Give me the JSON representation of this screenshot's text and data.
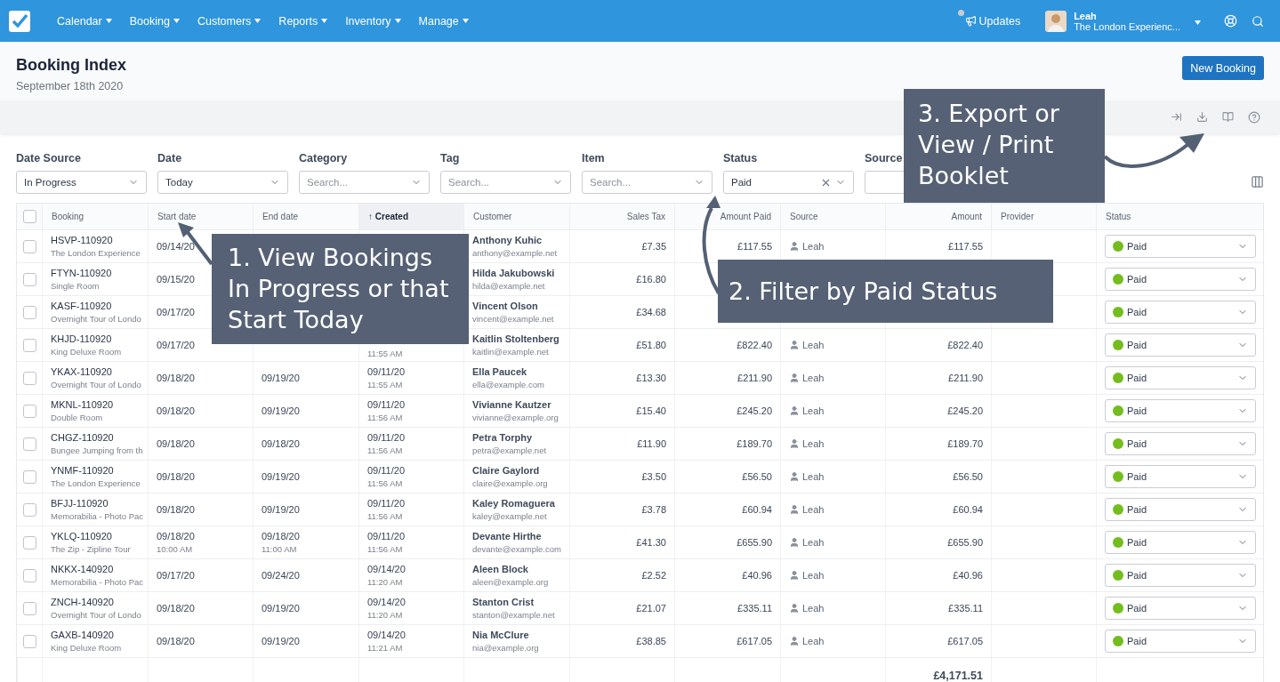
{
  "nav": {
    "menus": [
      {
        "label": "Calendar"
      },
      {
        "label": "Booking"
      },
      {
        "label": "Customers"
      },
      {
        "label": "Reports"
      },
      {
        "label": "Inventory"
      },
      {
        "label": "Manage"
      }
    ],
    "updates": {
      "label": "Updates",
      "unread": true
    },
    "user": {
      "name": "Leah",
      "company": "The London Experienc..."
    }
  },
  "header": {
    "title": "Booking Index",
    "date": "September 18th 2020",
    "button": "New Booking"
  },
  "filters": [
    {
      "label": "Date Source",
      "value": "In Progress",
      "clearable": false
    },
    {
      "label": "Date",
      "value": "Today",
      "clearable": false
    },
    {
      "label": "Category",
      "placeholder": "Search...",
      "clearable": false
    },
    {
      "label": "Tag",
      "placeholder": "Search...",
      "clearable": false
    },
    {
      "label": "Item",
      "placeholder": "Search...",
      "clearable": false
    },
    {
      "label": "Status",
      "value": "Paid",
      "clearable": true
    },
    {
      "label": "Source"
    }
  ],
  "callouts": [
    {
      "text": "3. Export or View / Print Booklet"
    },
    {
      "text": "1. View Bookings In Progress or that Start Today"
    },
    {
      "text": "2. Filter by Paid Status"
    }
  ],
  "table": {
    "select_all": {
      "checked": false
    },
    "columns": [
      {
        "label": "Booking",
        "kind": "text",
        "sorted": false
      },
      {
        "label": "Start date",
        "kind": "text",
        "sorted": false
      },
      {
        "label": "End date",
        "kind": "text",
        "sorted": false
      },
      {
        "label": "Created",
        "kind": "text",
        "sorted": true,
        "sort_mark": "↑"
      },
      {
        "label": "Customer",
        "kind": "text",
        "sorted": false
      },
      {
        "label": "Sales Tax",
        "kind": "money",
        "sorted": false
      },
      {
        "label": "Amount Paid",
        "kind": "money",
        "sorted": false
      },
      {
        "label": "Source",
        "kind": "text",
        "sorted": false
      },
      {
        "label": "Amount",
        "kind": "money",
        "sorted": false
      },
      {
        "label": "Provider",
        "kind": "text",
        "sorted": false
      },
      {
        "label": "Status",
        "kind": "text",
        "sorted": false
      }
    ],
    "rows": [
      {
        "checked": false,
        "code": "HSVP-110920",
        "item": "The London Experience",
        "start": {
          "date": "09/14/20"
        },
        "customer": "Anthony Kuhic",
        "email": "anthony@example.net",
        "tax": "£7.35",
        "paid": "£117.55",
        "source": "Leah",
        "amount": "£117.55",
        "status": "Paid",
        "color": "#73bd1f"
      },
      {
        "checked": false,
        "code": "FTYN-110920",
        "item": "Single Room",
        "start": {
          "date": "09/15/20"
        },
        "customer": "Hilda Jakubowski",
        "email": "hilda@example.net",
        "tax": "£16.80",
        "status": "Paid",
        "color": "#73bd1f"
      },
      {
        "checked": false,
        "code": "KASF-110920",
        "item": "Overnight Tour of Londo",
        "start": {
          "date": "09/17/20"
        },
        "customer": "Vincent Olson",
        "email": "vincent@example.net",
        "tax": "£34.68",
        "status": "Paid",
        "color": "#73bd1f"
      },
      {
        "checked": false,
        "code": "KHJD-110920",
        "item": "King Deluxe Room",
        "start": {
          "date": "09/17/20"
        },
        "created": {
          "time": "11:55 AM"
        },
        "customer": "Kaitlin Stoltenberg",
        "email": "kaitlin@example.net",
        "tax": "£51.80",
        "paid": "£822.40",
        "source": "Leah",
        "amount": "£822.40",
        "status": "Paid",
        "color": "#73bd1f"
      },
      {
        "checked": false,
        "code": "YKAX-110920",
        "item": "Overnight Tour of Londo",
        "start": {
          "date": "09/18/20"
        },
        "end": {
          "date": "09/19/20"
        },
        "created": {
          "date": "09/11/20",
          "time": "11:55 AM"
        },
        "customer": "Ella Paucek",
        "email": "ella@example.com",
        "tax": "£13.30",
        "paid": "£211.90",
        "source": "Leah",
        "amount": "£211.90",
        "status": "Paid",
        "color": "#73bd1f"
      },
      {
        "checked": false,
        "code": "MKNL-110920",
        "item": "Double Room",
        "start": {
          "date": "09/18/20"
        },
        "end": {
          "date": "09/19/20"
        },
        "created": {
          "date": "09/11/20",
          "time": "11:56 AM"
        },
        "customer": "Vivianne Kautzer",
        "email": "vivianne@example.org",
        "tax": "£15.40",
        "paid": "£245.20",
        "source": "Leah",
        "amount": "£245.20",
        "status": "Paid",
        "color": "#73bd1f"
      },
      {
        "checked": false,
        "code": "CHGZ-110920",
        "item": "Bungee Jumping from th",
        "start": {
          "date": "09/18/20"
        },
        "end": {
          "date": "09/18/20"
        },
        "created": {
          "date": "09/11/20",
          "time": "11:56 AM"
        },
        "customer": "Petra Torphy",
        "email": "petra@example.net",
        "tax": "£11.90",
        "paid": "£189.70",
        "source": "Leah",
        "amount": "£189.70",
        "status": "Paid",
        "color": "#73bd1f"
      },
      {
        "checked": false,
        "code": "YNMF-110920",
        "item": "The London Experience",
        "start": {
          "date": "09/18/20"
        },
        "end": {
          "date": "09/19/20"
        },
        "created": {
          "date": "09/11/20",
          "time": "11:56 AM"
        },
        "customer": "Claire Gaylord",
        "email": "claire@example.org",
        "tax": "£3.50",
        "paid": "£56.50",
        "source": "Leah",
        "amount": "£56.50",
        "status": "Paid",
        "color": "#73bd1f"
      },
      {
        "checked": false,
        "code": "BFJJ-110920",
        "item": "Memorabilia - Photo Pac",
        "start": {
          "date": "09/18/20"
        },
        "end": {
          "date": "09/19/20"
        },
        "created": {
          "date": "09/11/20",
          "time": "11:56 AM"
        },
        "customer": "Kaley Romaguera",
        "email": "kaley@example.net",
        "tax": "£3.78",
        "paid": "£60.94",
        "source": "Leah",
        "amount": "£60.94",
        "status": "Paid",
        "color": "#73bd1f"
      },
      {
        "checked": false,
        "code": "YKLQ-110920",
        "item": "The Zip - Zipline Tour",
        "start": {
          "date": "09/18/20",
          "time": "10:00 AM"
        },
        "end": {
          "date": "09/18/20",
          "time": "11:00 AM"
        },
        "created": {
          "date": "09/11/20",
          "time": "11:56 AM"
        },
        "customer": "Devante Hirthe",
        "email": "devante@example.com",
        "tax": "£41.30",
        "paid": "£655.90",
        "source": "Leah",
        "amount": "£655.90",
        "status": "Paid",
        "color": "#73bd1f"
      },
      {
        "checked": false,
        "code": "NKKX-140920",
        "item": "Memorabilia - Photo Pac",
        "start": {
          "date": "09/17/20"
        },
        "end": {
          "date": "09/24/20"
        },
        "created": {
          "date": "09/14/20",
          "time": "11:20 AM"
        },
        "customer": "Aleen Block",
        "email": "aleen@example.org",
        "tax": "£2.52",
        "paid": "£40.96",
        "source": "Leah",
        "amount": "£40.96",
        "status": "Paid",
        "color": "#73bd1f"
      },
      {
        "checked": false,
        "code": "ZNCH-140920",
        "item": "Overnight Tour of Londo",
        "start": {
          "date": "09/18/20"
        },
        "end": {
          "date": "09/19/20"
        },
        "created": {
          "date": "09/14/20",
          "time": "11:20 AM"
        },
        "customer": "Stanton Crist",
        "email": "stanton@example.net",
        "tax": "£21.07",
        "paid": "£335.11",
        "source": "Leah",
        "amount": "£335.11",
        "status": "Paid",
        "color": "#73bd1f"
      },
      {
        "checked": false,
        "code": "GAXB-140920",
        "item": "King Deluxe Room",
        "start": {
          "date": "09/18/20"
        },
        "end": {
          "date": "09/19/20"
        },
        "created": {
          "date": "09/14/20",
          "time": "11:21 AM"
        },
        "customer": "Nia McClure",
        "email": "nia@example.org",
        "tax": "£38.85",
        "paid": "£617.05",
        "source": "Leah",
        "amount": "£617.05",
        "status": "Paid",
        "color": "#73bd1f"
      }
    ],
    "total": "£4,171.51"
  }
}
